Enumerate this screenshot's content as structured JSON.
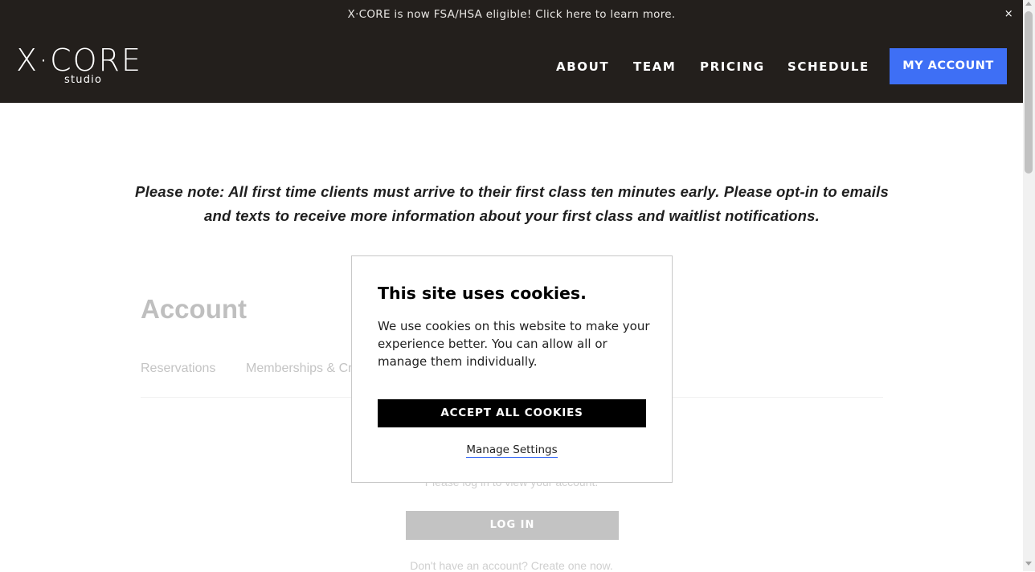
{
  "announcement": {
    "text": "X·CORE is now FSA/HSA eligible! Click here to learn more.",
    "close_label": "×"
  },
  "header": {
    "logo": {
      "main": "X·CORE",
      "sub": "studio"
    },
    "nav": {
      "about": "ABOUT",
      "team": "TEAM",
      "pricing": "PRICING",
      "schedule": "SCHEDULE"
    },
    "account_button": "MY ACCOUNT"
  },
  "note": {
    "line1": "Please note: All first time clients must arrive to their first class ten minutes early. Please opt-in to emails",
    "line2": "and texts to receive more information about your first class and waitlist notifications."
  },
  "account": {
    "title": "Account",
    "tabs": [
      "Reservations",
      "Memberships & Cr"
    ],
    "login_prompt": "Please log in to view your account.",
    "login_button": "LOG IN",
    "signup_text": "Don't have an account? Create one now."
  },
  "cookie_modal": {
    "title": "This site uses cookies.",
    "body": "We use cookies on this website to make your experience better. You can allow all or manage them individually.",
    "accept_button": "ACCEPT ALL COOKIES",
    "manage_link": "Manage Settings"
  },
  "colors": {
    "header_bg": "#231f1c",
    "accent": "#3e6ff5",
    "accept_button_bg": "#000000"
  }
}
